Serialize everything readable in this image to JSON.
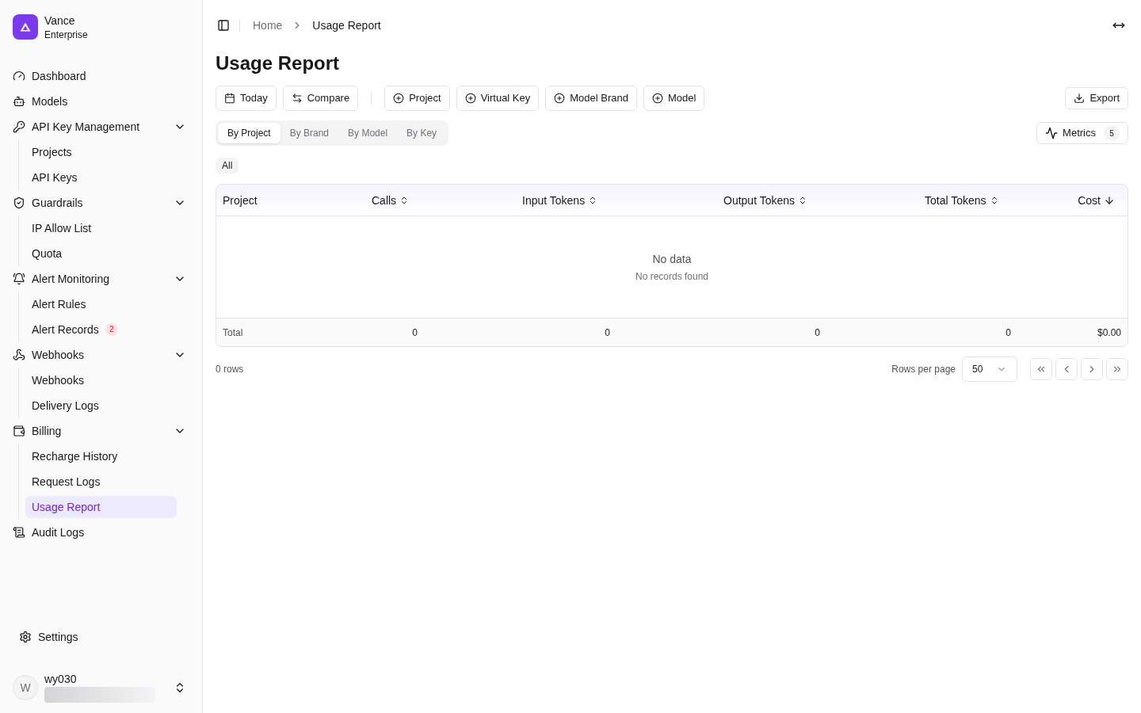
{
  "brand": {
    "name": "Vance",
    "plan": "Enterprise"
  },
  "nav": [
    {
      "label": "Dashboard",
      "selected": false
    },
    {
      "label": "Models",
      "selected": false
    },
    {
      "label": "API Key Management",
      "selected": false,
      "expanded": true,
      "children": [
        {
          "label": "Projects",
          "selected": false
        },
        {
          "label": "API Keys",
          "selected": false
        }
      ]
    },
    {
      "label": "Guardrails",
      "selected": false,
      "expanded": true,
      "children": [
        {
          "label": "IP Allow List",
          "selected": false
        },
        {
          "label": "Quota",
          "selected": false
        }
      ]
    },
    {
      "label": "Alert Monitoring",
      "selected": false,
      "expanded": true,
      "children": [
        {
          "label": "Alert Rules",
          "selected": false
        },
        {
          "label": "Alert Records",
          "selected": false,
          "badge": "2"
        }
      ]
    },
    {
      "label": "Webhooks",
      "selected": false,
      "expanded": true,
      "children": [
        {
          "label": "Webhooks",
          "selected": false
        },
        {
          "label": "Delivery Logs",
          "selected": false
        }
      ]
    },
    {
      "label": "Billing",
      "selected": false,
      "expanded": true,
      "children": [
        {
          "label": "Recharge History",
          "selected": false
        },
        {
          "label": "Request Logs",
          "selected": false
        },
        {
          "label": "Usage Report",
          "selected": true
        }
      ]
    },
    {
      "label": "Audit Logs",
      "selected": false
    }
  ],
  "settings": "Settings",
  "user": {
    "initial": "W",
    "name": "wy030"
  },
  "breadcrumb": [
    "Home",
    "Usage Report"
  ],
  "title": "Usage Report",
  "toolbar": [
    {
      "kind": "date",
      "label": "Today"
    },
    {
      "kind": "compare",
      "label": "Compare"
    },
    {
      "kind": "divider"
    },
    {
      "kind": "filter",
      "label": "Project"
    },
    {
      "kind": "filter",
      "label": "Virtual Key"
    },
    {
      "kind": "filter",
      "label": "Model Brand"
    },
    {
      "kind": "filter",
      "label": "Model"
    }
  ],
  "export": "Export",
  "tabs": [
    {
      "label": "By Project",
      "selected": true
    },
    {
      "label": "By Brand",
      "selected": false
    },
    {
      "label": "By Model",
      "selected": false
    },
    {
      "label": "By Key",
      "selected": false
    }
  ],
  "metrics": {
    "label": "Metrics",
    "count": "5"
  },
  "filter_chip": "All",
  "table": {
    "columns": [
      "Project",
      "Calls",
      "Input Tokens",
      "Output Tokens",
      "Total Tokens",
      "Cost"
    ],
    "empty_title": "No data",
    "empty_text": "No records found",
    "footer": [
      "Total",
      "0",
      "0",
      "0",
      "0",
      "$0.00"
    ]
  },
  "row_count": "0 rows",
  "rows_per_page": {
    "label": "Rows per page",
    "value": "50"
  }
}
